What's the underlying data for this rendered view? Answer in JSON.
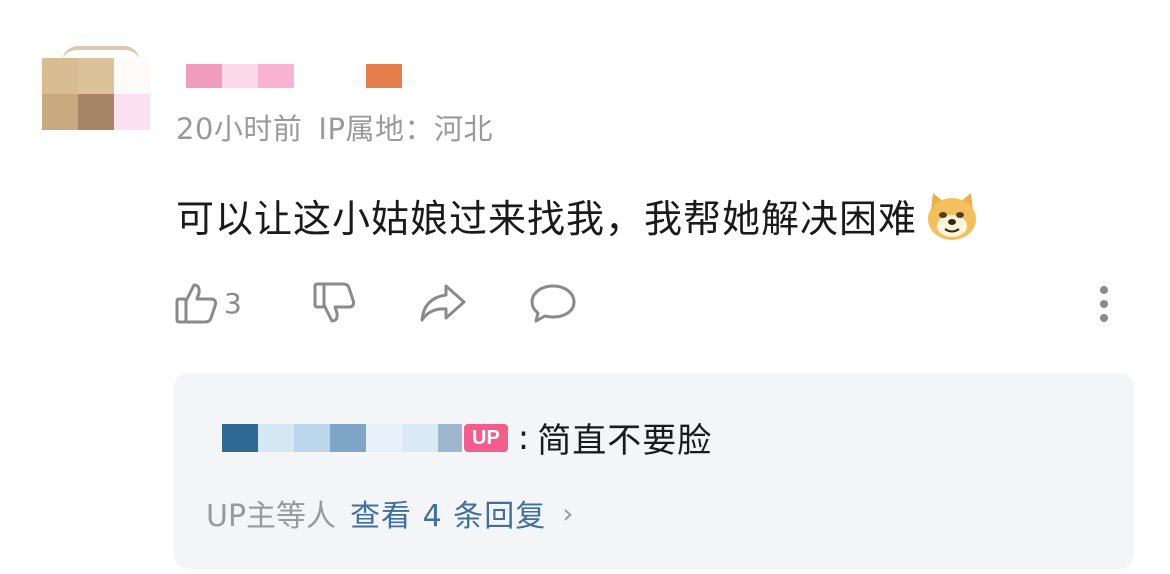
{
  "comment": {
    "meta": {
      "time": "20小时前",
      "ip_location": "IP属地：河北"
    },
    "content": "可以让这小姑娘过来找我，我帮她解决困难",
    "emoji_icon": "doge-emoji",
    "actions": {
      "like_count": "3"
    }
  },
  "reply_preview": {
    "up_tag": "UP",
    "colon": ":",
    "text": "简直不要脸",
    "summary_prefix": "UP主等人",
    "summary_link": "查看 4 条回复",
    "chevron": "›"
  },
  "colors": {
    "reply_link": "#3f6f9f",
    "up_tag": "#f25d8e",
    "meta_text": "#9a9a9a"
  }
}
